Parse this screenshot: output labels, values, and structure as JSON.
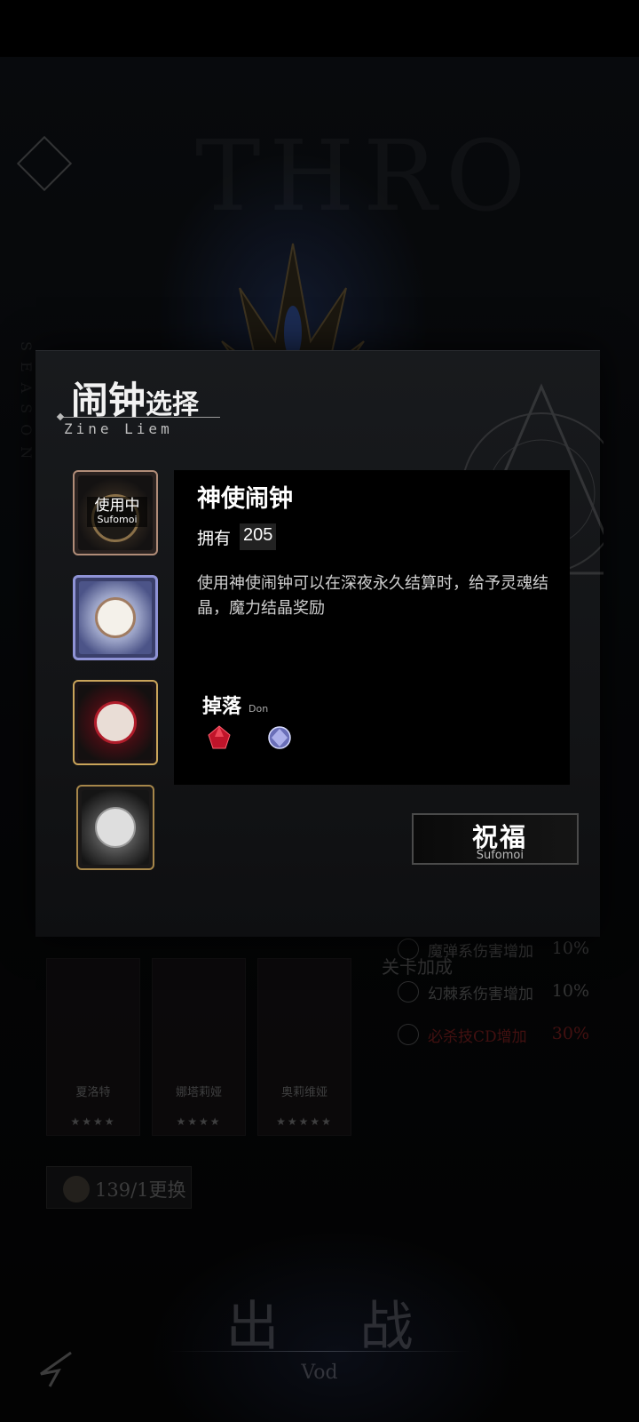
{
  "background": {
    "title": "THRO",
    "side_text": "SEASON"
  },
  "team": [
    {
      "name": "夏洛特",
      "stars": "★★★★"
    },
    {
      "name": "娜塔莉娅",
      "stars": "★★★★"
    },
    {
      "name": "奥莉维娅",
      "stars": "★★★★★"
    }
  ],
  "bonus": {
    "title": "关卡加成",
    "rows": [
      {
        "label": "魔弹系伤害增加",
        "value": "10%"
      },
      {
        "label": "幻棘系伤害增加",
        "value": "10%"
      },
      {
        "label": "必杀技CD增加",
        "value": "30%"
      }
    ]
  },
  "swap": {
    "count": "139/1",
    "label": "更换"
  },
  "sortie": {
    "label": "出 战",
    "sub": "Vod"
  },
  "modal": {
    "title_big": "闹钟",
    "title_small": "选择",
    "subtitle": "Zine Liem",
    "in_use": {
      "label": "使用中",
      "sub": "Sufomoi"
    },
    "detail": {
      "name": "神使闹钟",
      "own_label": "拥有",
      "own_value": "205",
      "description": "使用神使闹钟可以在深夜永久结算时，给予灵魂结晶，魔力结晶奖励",
      "drop_label": "掉落",
      "drop_sub": "Don"
    },
    "bless_button": {
      "label": "祝福",
      "sub": "Sufomoi"
    }
  },
  "colors": {
    "selected_border": "#8f93d6",
    "gold_border": "#c9a45a",
    "red_accent": "#b01c2a"
  }
}
